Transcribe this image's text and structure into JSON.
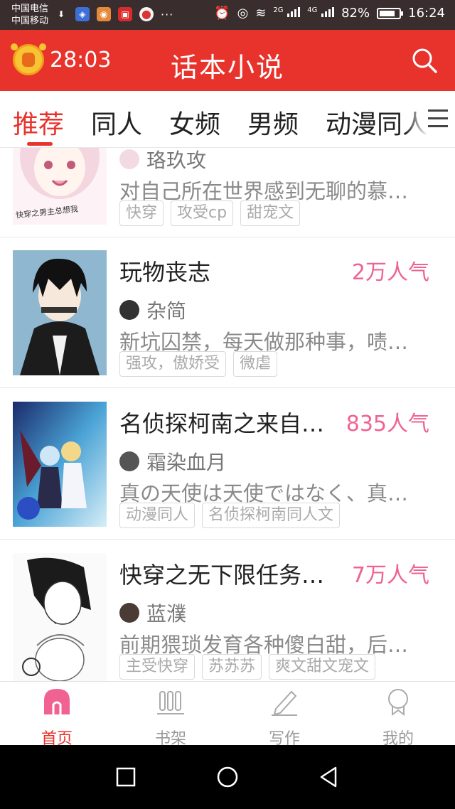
{
  "status_bar": {
    "carrier_1": "中国电信",
    "carrier_2": "中国移动",
    "network_1": "2G",
    "network_2": "4G",
    "battery": "82%",
    "battery_level": 0.82,
    "time": "16:24"
  },
  "header": {
    "timer": "28:03",
    "title": "话本小说",
    "accent_color": "#e8322c"
  },
  "tabs": [
    {
      "label": "推荐",
      "active": true
    },
    {
      "label": "同人",
      "active": false
    },
    {
      "label": "女频",
      "active": false
    },
    {
      "label": "男频",
      "active": false
    },
    {
      "label": "动漫同人",
      "active": false
    }
  ],
  "feed": [
    {
      "title": "",
      "popularity": "",
      "author": "珞玖攻",
      "description": "对自己所在世界感到无聊的慕…",
      "tags": [
        "快穿",
        "攻受cp",
        "甜宠文"
      ],
      "cover_text": "快穿之男主总想我"
    },
    {
      "title": "玩物丧志",
      "popularity": "2万人气",
      "author": "杂简",
      "description": "新坑囚禁，每天做那种事，啧…",
      "tags": [
        "强攻，傲娇受",
        "微虐"
      ]
    },
    {
      "title": "名侦探柯南之来自…",
      "popularity": "835人气",
      "author": "霜染血月",
      "description": "真の天使は天使ではなく、真…",
      "tags": [
        "动漫同人",
        "名侦探柯南同人文"
      ]
    },
    {
      "title": "快穿之无下限任务…",
      "popularity": "7万人气",
      "author": "蓝濮",
      "description": "前期猥琐发育各种傻白甜，后…",
      "tags": [
        "主受快穿",
        "苏苏苏",
        "爽文甜文宠文"
      ]
    }
  ],
  "bottom_nav": [
    {
      "label": "首页",
      "icon": "home-icon",
      "active": true
    },
    {
      "label": "书架",
      "icon": "bookshelf-icon",
      "active": false
    },
    {
      "label": "写作",
      "icon": "pencil-icon",
      "active": false
    },
    {
      "label": "我的",
      "icon": "profile-icon",
      "active": false
    }
  ]
}
